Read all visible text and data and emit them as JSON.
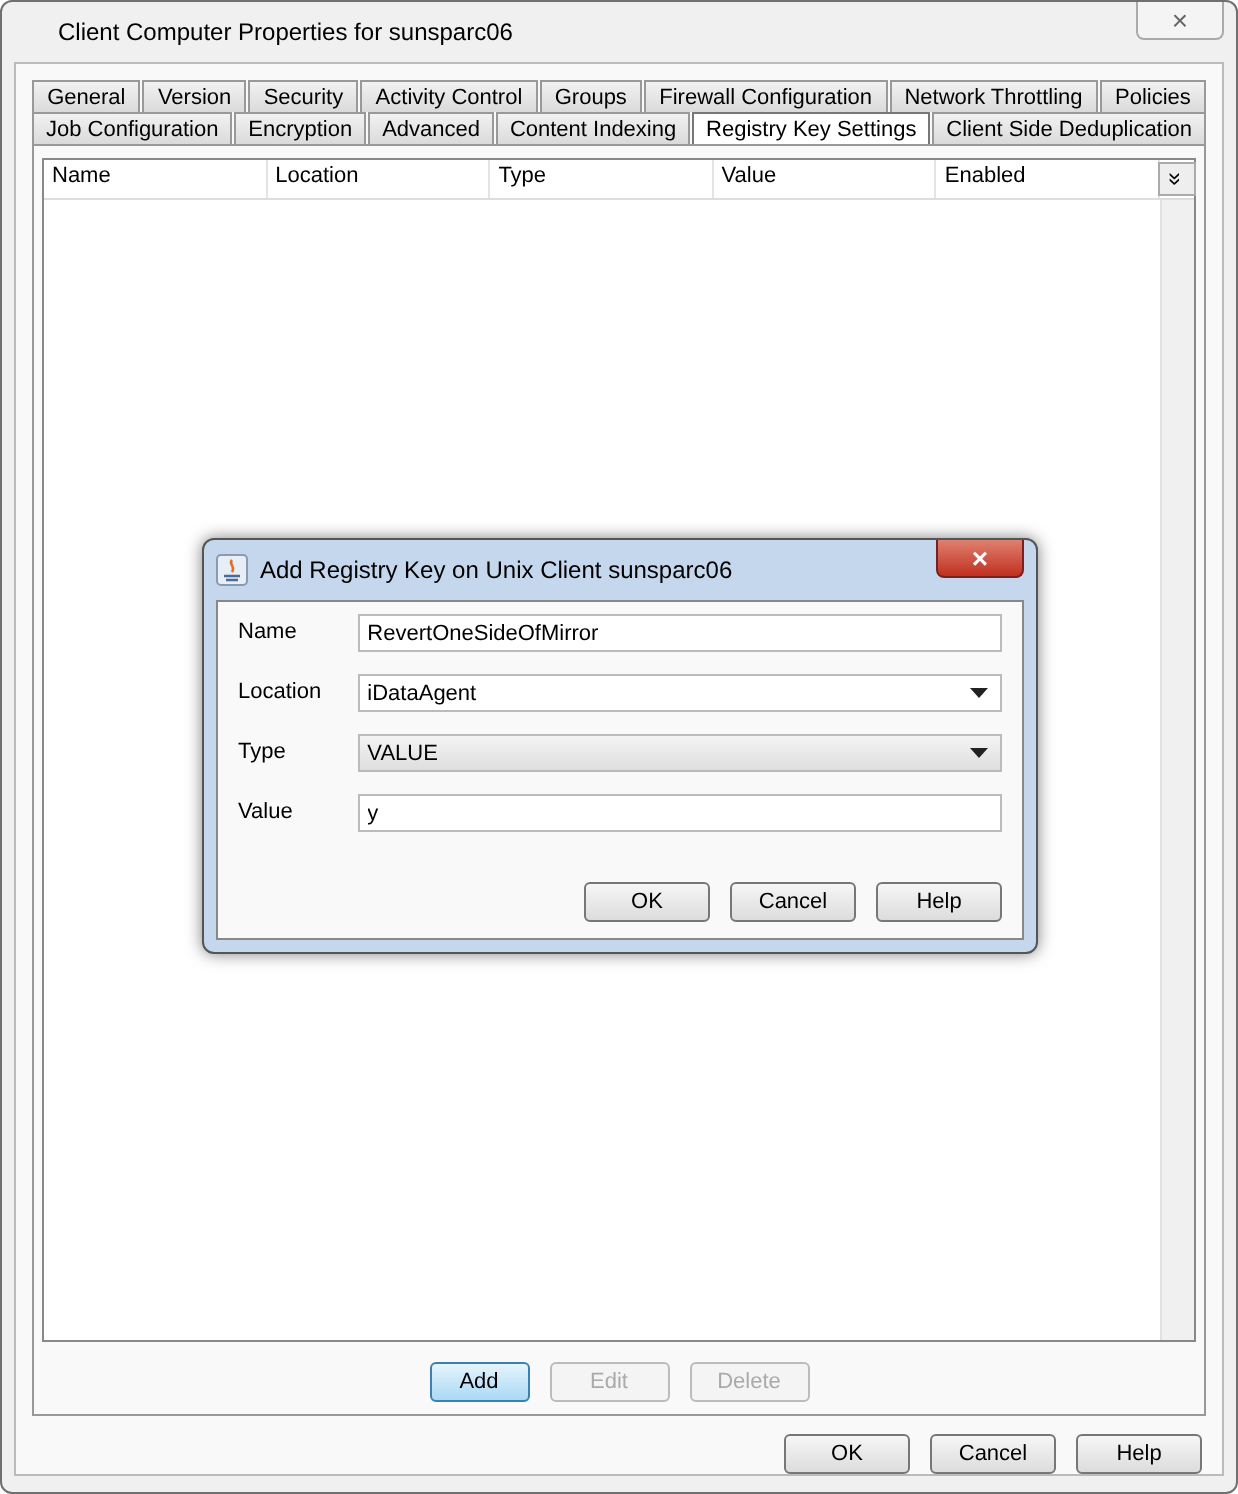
{
  "window": {
    "title": "Client Computer Properties for sunsparc06",
    "close_label": "×"
  },
  "tab_rows": [
    {
      "tabs": [
        {
          "label": "General",
          "selected": false
        },
        {
          "label": "Version",
          "selected": false
        },
        {
          "label": "Security",
          "selected": false
        },
        {
          "label": "Activity Control",
          "selected": false
        },
        {
          "label": "Groups",
          "selected": false
        },
        {
          "label": "Firewall Configuration",
          "selected": false
        },
        {
          "label": "Network Throttling",
          "selected": false
        },
        {
          "label": "Policies",
          "selected": false
        }
      ]
    },
    {
      "tabs": [
        {
          "label": "Job Configuration",
          "selected": false
        },
        {
          "label": "Encryption",
          "selected": false
        },
        {
          "label": "Advanced",
          "selected": false
        },
        {
          "label": "Content Indexing",
          "selected": false
        },
        {
          "label": "Registry Key Settings",
          "selected": true
        },
        {
          "label": "Client Side Deduplication",
          "selected": false
        }
      ]
    }
  ],
  "table": {
    "columns": [
      "Name",
      "Location",
      "Type",
      "Value",
      "Enabled"
    ],
    "column_menu_label": "»"
  },
  "table_buttons": [
    {
      "label": "Add",
      "disabled": false,
      "focused": true
    },
    {
      "label": "Edit",
      "disabled": true,
      "focused": false
    },
    {
      "label": "Delete",
      "disabled": true,
      "focused": false
    }
  ],
  "dialog": {
    "title": "Add Registry Key on Unix Client sunsparc06",
    "close_label": "×",
    "fields": [
      {
        "kind": "text",
        "label": "Name",
        "value": "RevertOneSideOfMirror"
      },
      {
        "kind": "dropdown",
        "label": "Location",
        "value": "iDataAgent"
      },
      {
        "kind": "dropdown",
        "label": "Type",
        "value": "VALUE"
      },
      {
        "kind": "text",
        "label": "Value",
        "value": "y"
      }
    ],
    "buttons": [
      "OK",
      "Cancel",
      "Help"
    ]
  },
  "buttons": [
    "OK",
    "Cancel",
    "Help"
  ]
}
